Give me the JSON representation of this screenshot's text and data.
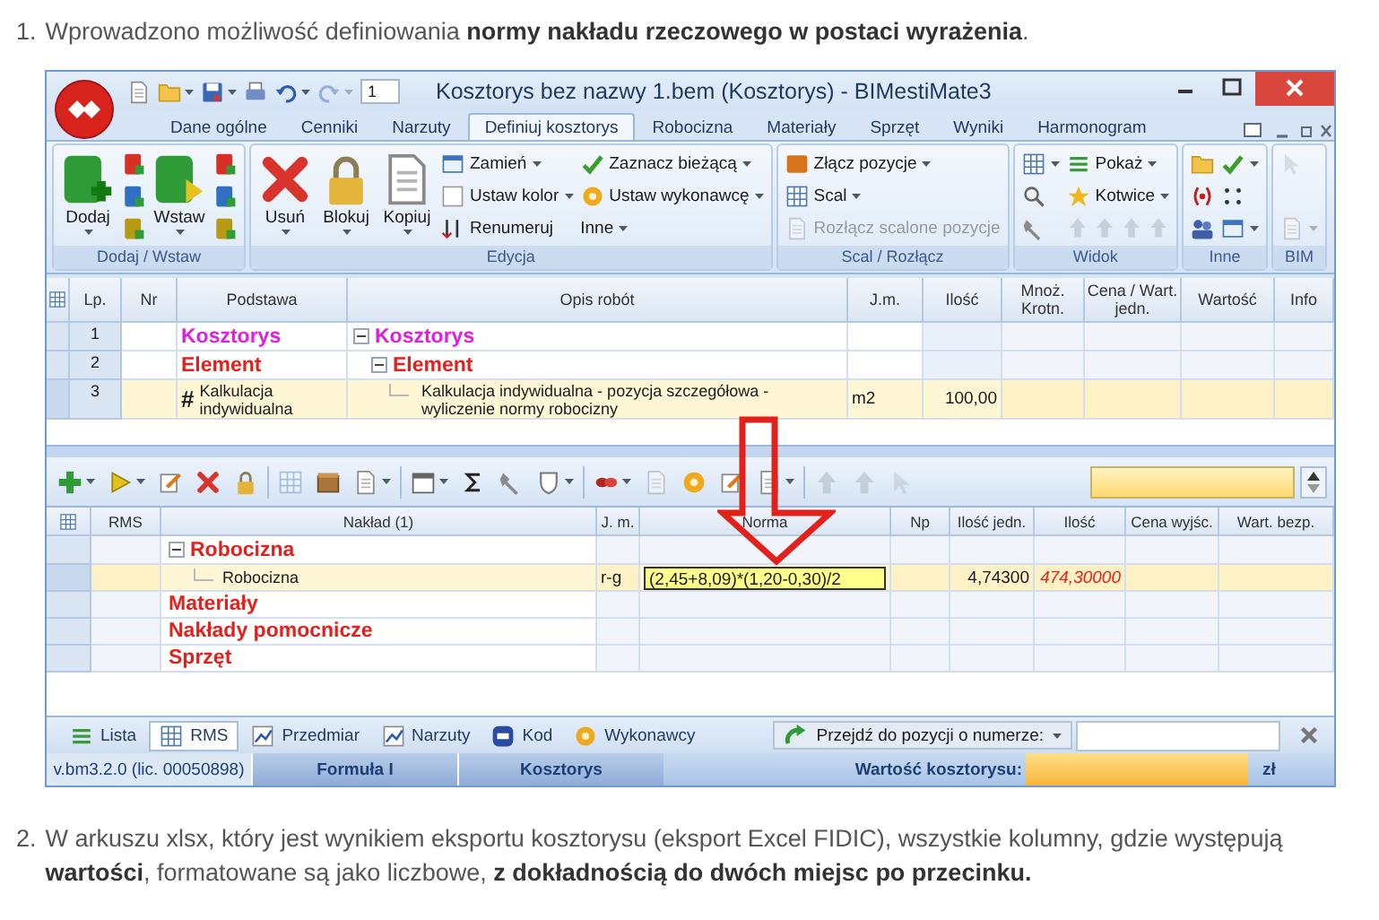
{
  "intro": {
    "number": "1.",
    "text": "Wprowadzono możliwość definiowania **normy nakładu rzeczowego w postaci wyrażenia**."
  },
  "window": {
    "title": "Kosztorys bez nazwy 1.bem (Kosztorys) - BIMestiMate3",
    "quick_access": {
      "buttons": [
        {
          "dropdown": false,
          "disabled": false
        },
        {
          "dropdown": true,
          "disabled": false
        },
        {
          "dropdown": true,
          "disabled": false
        },
        {
          "dropdown": false,
          "disabled": false
        },
        {
          "dropdown": true,
          "disabled": false
        },
        {
          "dropdown": true,
          "disabled": true
        }
      ],
      "counter": "1"
    },
    "tabs": [
      {
        "label": "Dane ogólne",
        "selected": false
      },
      {
        "label": "Cenniki",
        "selected": false
      },
      {
        "label": "Narzuty",
        "selected": false
      },
      {
        "label": "Definiuj kosztorys",
        "selected": true
      },
      {
        "label": "Robocizna",
        "selected": false
      },
      {
        "label": "Materiały",
        "selected": false
      },
      {
        "label": "Sprzęt",
        "selected": false
      },
      {
        "label": "Wyniki",
        "selected": false
      },
      {
        "label": "Harmonogram",
        "selected": false
      }
    ],
    "ribbon": {
      "groups": [
        {
          "label": "Dodaj / Wstaw",
          "columns": [
            {
              "items": [
                {
                  "kind": "large",
                  "label": "Dodaj",
                  "dropdown": true,
                  "disabled": false
                }
              ]
            },
            {
              "items": [
                {
                  "kind": "small",
                  "dropdown": false,
                  "disabled": false
                },
                {
                  "kind": "small",
                  "dropdown": false,
                  "disabled": false
                },
                {
                  "kind": "small",
                  "dropdown": false,
                  "disabled": false
                }
              ]
            },
            {
              "items": [
                {
                  "kind": "large",
                  "label": "Wstaw",
                  "dropdown": true,
                  "disabled": false
                }
              ]
            },
            {
              "items": [
                {
                  "kind": "small",
                  "dropdown": false,
                  "disabled": false
                },
                {
                  "kind": "small",
                  "dropdown": false,
                  "disabled": false
                },
                {
                  "kind": "small",
                  "dropdown": false,
                  "disabled": false
                }
              ]
            }
          ]
        },
        {
          "label": "Edycja",
          "columns": [
            {
              "items": [
                {
                  "kind": "large",
                  "label": "Usuń",
                  "dropdown": true,
                  "disabled": false
                }
              ]
            },
            {
              "items": [
                {
                  "kind": "large",
                  "label": "Blokuj",
                  "dropdown": true,
                  "disabled": false
                }
              ]
            },
            {
              "items": [
                {
                  "kind": "large",
                  "label": "Kopiuj",
                  "dropdown": true,
                  "disabled": false
                }
              ]
            },
            {
              "items": [
                {
                  "kind": "small",
                  "label": "Zamień",
                  "dropdown": true,
                  "disabled": false
                },
                {
                  "kind": "small",
                  "label": "Ustaw kolor",
                  "dropdown": true,
                  "disabled": false
                },
                {
                  "kind": "small",
                  "label": "Renumeruj",
                  "dropdown": false,
                  "disabled": false
                }
              ]
            },
            {
              "items": [
                {
                  "kind": "small",
                  "label": "Zaznacz bieżącą",
                  "dropdown": true,
                  "disabled": false
                },
                {
                  "kind": "small",
                  "label": "Ustaw wykonawcę",
                  "dropdown": true,
                  "disabled": false
                },
                {
                  "kind": "small",
                  "label": "Inne",
                  "dropdown": true,
                  "disabled": false
                }
              ]
            }
          ]
        },
        {
          "label": "Scal / Rozłącz",
          "columns": [
            {
              "items": [
                {
                  "kind": "small",
                  "label": "Złącz pozycje",
                  "dropdown": true,
                  "disabled": false
                },
                {
                  "kind": "small",
                  "label": "Scal",
                  "dropdown": true,
                  "disabled": false
                },
                {
                  "kind": "small",
                  "label": "Rozłącz scalone pozycje",
                  "dropdown": false,
                  "disabled": true
                }
              ]
            }
          ]
        },
        {
          "label": "Widok",
          "columns": [
            {
              "items": [
                {
                  "kind": "small",
                  "dropdown": true,
                  "disabled": false
                },
                {
                  "kind": "small",
                  "dropdown": false,
                  "disabled": false
                },
                {
                  "kind": "small",
                  "dropdown": false,
                  "disabled": false
                }
              ]
            },
            {
              "items": [
                {
                  "kind": "small",
                  "label": "Pokaż",
                  "dropdown": true,
                  "disabled": false
                },
                {
                  "kind": "small",
                  "label": "Kotwice",
                  "dropdown": true,
                  "disabled": false
                },
                {
                  "kind": "strip",
                  "buttons": [
                    {
                      "disabled": true
                    },
                    {
                      "disabled": true
                    },
                    {
                      "disabled": true
                    },
                    {
                      "disabled": true
                    }
                  ]
                }
              ]
            }
          ]
        },
        {
          "label": "Inne",
          "columns": [
            {
              "items": [
                {
                  "kind": "small",
                  "dropdown": false,
                  "disabled": false
                },
                {
                  "kind": "small",
                  "dropdown": false,
                  "disabled": false
                },
                {
                  "kind": "small",
                  "dropdown": false,
                  "disabled": false
                }
              ]
            },
            {
              "items": [
                {
                  "kind": "small",
                  "dropdown": true,
                  "disabled": false
                },
                {
                  "kind": "small",
                  "dropdown": false,
                  "disabled": false
                },
                {
                  "kind": "small",
                  "dropdown": true,
                  "disabled": false
                }
              ]
            }
          ]
        },
        {
          "label": "BIM",
          "columns": [
            {
              "items": [
                {
                  "kind": "small",
                  "dropdown": false,
                  "disabled": true
                },
                {
                  "kind": "small",
                  "dropdown": true,
                  "disabled": true
                }
              ]
            }
          ]
        }
      ]
    },
    "estimate_table": {
      "columns": [
        "Lp.",
        "Nr",
        "Podstawa",
        "Opis robót",
        "J.m.",
        "Ilość",
        "Mnoż. Krotn.",
        "Cena / Wart. jedn.",
        "Wartość",
        "Info"
      ],
      "rows": [
        {
          "lp": "1",
          "kind": "estimate",
          "podstawa": "Kosztorys",
          "opis": "Kosztorys",
          "selected": false,
          "expanded": true,
          "children": [
            {
              "lp": "2",
              "kind": "element",
              "podstawa": "Element",
              "opis": "Element",
              "selected": false,
              "expanded": true,
              "children": [
                {
                  "lp": "3",
                  "kind": "position",
                  "symbol": "#",
                  "podstawa": "Kalkulacja indywidualna",
                  "opis": "Kalkulacja indywidualna - pozycja szczegółowa - wyliczenie normy robocizny",
                  "jm": "m2",
                  "ilosc": "100,00",
                  "selected": true
                }
              ]
            }
          ]
        }
      ]
    },
    "resource_toolbar": {
      "buttons": [
        {
          "dropdown": true,
          "disabled": false
        },
        {
          "dropdown": true,
          "disabled": false
        },
        {
          "dropdown": false,
          "disabled": false
        },
        {
          "dropdown": false,
          "disabled": false
        },
        {
          "dropdown": false,
          "disabled": false
        },
        {
          "dropdown": false,
          "disabled": true
        },
        {
          "dropdown": false,
          "disabled": false
        },
        {
          "dropdown": true,
          "disabled": false
        },
        {
          "dropdown": true,
          "disabled": false
        },
        {
          "dropdown": false,
          "disabled": false
        },
        {
          "dropdown": false,
          "disabled": false
        },
        {
          "dropdown": true,
          "disabled": false
        },
        {
          "dropdown": true,
          "disabled": false
        },
        {
          "dropdown": false,
          "disabled": true
        },
        {
          "dropdown": false,
          "disabled": false
        },
        {
          "dropdown": false,
          "disabled": false
        },
        {
          "dropdown": true,
          "disabled": false
        },
        {
          "dropdown": false,
          "disabled": true
        },
        {
          "dropdown": false,
          "disabled": true
        },
        {
          "dropdown": false,
          "disabled": true
        }
      ]
    },
    "resource_table": {
      "columns": [
        "RMS",
        "Nakład (1)",
        "J. m.",
        "Norma",
        "Np",
        "Ilość jedn.",
        "Ilość",
        "Cena wyjśc.",
        "Wart. bezp."
      ],
      "rows": [
        {
          "kind": "category",
          "naklad": "Robocizna",
          "selected": false,
          "expanded": true,
          "children": [
            {
              "kind": "resource",
              "naklad": "Robocizna",
              "jm": "r-g",
              "norma": "(2,45+8,09)*(1,20-0,30)/2",
              "ilosc_jedn": "4,74300",
              "ilosc": "474,30000",
              "selected": true
            }
          ]
        },
        {
          "kind": "category",
          "naklad": "Materiały",
          "selected": false
        },
        {
          "kind": "category",
          "naklad": "Nakłady pomocnicze",
          "selected": false
        },
        {
          "kind": "category",
          "naklad": "Sprzęt",
          "selected": false
        }
      ]
    },
    "bottom_tabs": [
      {
        "label": "Lista",
        "selected": false
      },
      {
        "label": "RMS",
        "selected": true
      },
      {
        "label": "Przedmiar",
        "selected": false
      },
      {
        "label": "Narzuty",
        "selected": false
      },
      {
        "label": "Kod",
        "selected": false
      },
      {
        "label": "Wykonawcy",
        "selected": false
      }
    ],
    "goto": {
      "label": "Przejdź do pozycji o numerze:"
    },
    "status_bar": {
      "version": "v.bm3.2.0 (lic. 00050898)",
      "formula": "Formuła I",
      "mode": "Kosztorys",
      "total_label": "Wartość kosztorysu:",
      "currency": "zł"
    }
  },
  "outro": {
    "number": "2.",
    "text": "W arkuszu xlsx, który jest wynikiem eksportu kosztorysu (eksport Excel FIDIC), wszystkie kolumny, gdzie występują **wartości**, formatowane są jako liczbowe, **z dokładnością do dwóch miejsc po przecinku.**"
  }
}
